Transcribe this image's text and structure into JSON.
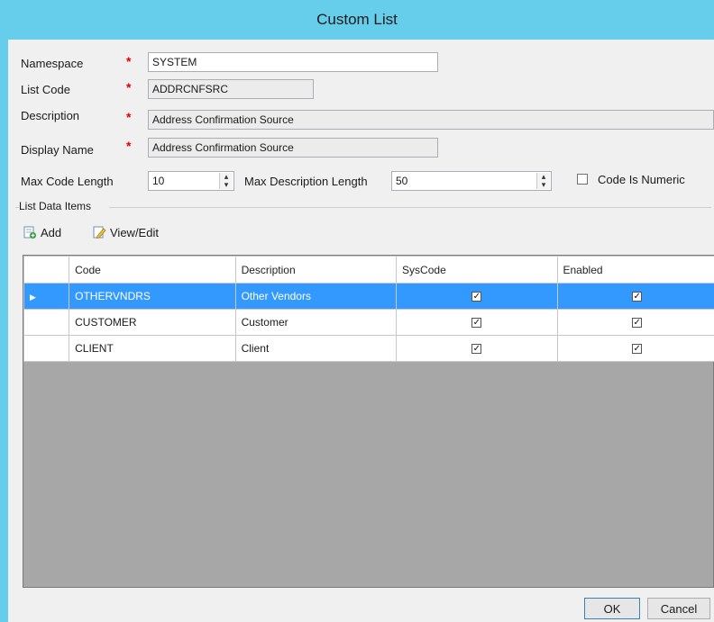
{
  "window": {
    "title": "Custom List"
  },
  "form": {
    "namespace_label": "Namespace",
    "namespace_value": "SYSTEM",
    "list_code_label": "List Code",
    "list_code_value": "ADDRCNFSRC",
    "description_label": "Description",
    "description_value": "Address Confirmation Source",
    "display_name_label": "Display Name",
    "display_name_value": "Address Confirmation Source",
    "max_code_length_label": "Max Code Length",
    "max_code_length_value": "10",
    "max_description_length_label": "Max Description Length",
    "max_description_length_value": "50",
    "code_is_numeric_label": "Code Is Numeric",
    "code_is_numeric_checked": false,
    "required_mark": "*"
  },
  "list_data_items": {
    "group_label": "List Data Items",
    "add_label": "Add",
    "view_edit_label": "View/Edit",
    "columns": [
      "Code",
      "Description",
      "SysCode",
      "Enabled"
    ],
    "rows": [
      {
        "code": "OTHERVNDRS",
        "description": "Other Vendors",
        "syscode": true,
        "enabled": true,
        "selected": true
      },
      {
        "code": "CUSTOMER",
        "description": "Customer",
        "syscode": true,
        "enabled": true,
        "selected": false
      },
      {
        "code": "CLIENT",
        "description": "Client",
        "syscode": true,
        "enabled": true,
        "selected": false
      }
    ]
  },
  "buttons": {
    "ok": "OK",
    "cancel": "Cancel"
  },
  "colors": {
    "titlebar": "#66cdea",
    "selection": "#3399ff",
    "required": "#e00000",
    "grid_empty": "#a7a7a7"
  }
}
